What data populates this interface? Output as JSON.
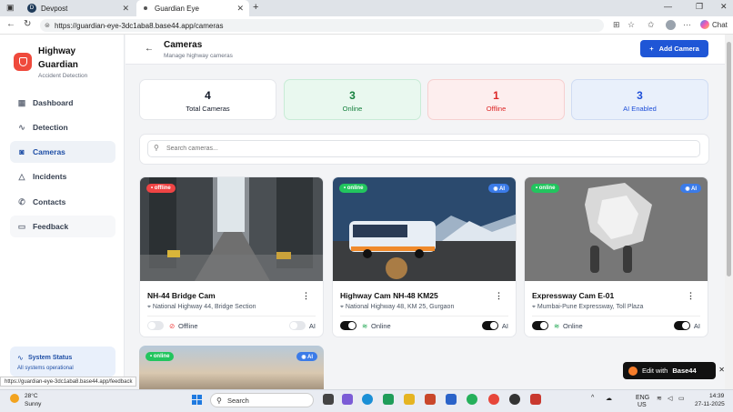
{
  "browser": {
    "tabs": [
      {
        "label": "Devpost",
        "favicon": "D"
      },
      {
        "label": "Guardian Eye"
      }
    ],
    "url": "https://guardian-eye-3dc1aba8.base44.app/cameras",
    "chat_label": "Chat"
  },
  "app": {
    "brand_line1": "Highway",
    "brand_line2": "Guardian",
    "brand_sub": "Accident Detection",
    "nav": [
      {
        "label": "Dashboard",
        "icon": "grid-icon"
      },
      {
        "label": "Detection",
        "icon": "activity-icon"
      },
      {
        "label": "Cameras",
        "icon": "camera-icon",
        "active": true
      },
      {
        "label": "Incidents",
        "icon": "warning-icon"
      },
      {
        "label": "Contacts",
        "icon": "phone-icon"
      },
      {
        "label": "Feedback",
        "icon": "feedback-icon"
      }
    ],
    "system_status": {
      "title": "System Status",
      "sub": "All systems operational"
    },
    "hover_url": "https://guardian-eye-3dc1aba8.base44.app/feedback"
  },
  "header": {
    "title": "Cameras",
    "subtitle": "Manage highway cameras",
    "add_button": "Add Camera"
  },
  "stats": [
    {
      "num": "4",
      "label": "Total Cameras",
      "color": "#111827",
      "bg": "#ffffff",
      "border": "#e5e7eb"
    },
    {
      "num": "3",
      "label": "Online",
      "color": "#15803d",
      "bg": "#e9f8ef",
      "border": "#c8ecd6"
    },
    {
      "num": "1",
      "label": "Offline",
      "color": "#dc2626",
      "bg": "#fdeeee",
      "border": "#f6d0d0"
    },
    {
      "num": "3",
      "label": "AI Enabled",
      "color": "#1d4ed8",
      "bg": "#e9f0fb",
      "border": "#cfdcf3"
    }
  ],
  "search": {
    "placeholder": "Search cameras..."
  },
  "cameras": [
    {
      "name": "NH-44 Bridge Cam",
      "location": "National Highway 44, Bridge Section",
      "status": "offline",
      "status_text": "Offline",
      "ai": false,
      "pill": "• offline"
    },
    {
      "name": "Highway Cam NH-48 KM25",
      "location": "National Highway 48, KM 25, Gurgaon",
      "status": "online",
      "status_text": "Online",
      "ai": true,
      "pill": "• online"
    },
    {
      "name": "Expressway Cam E-01",
      "location": "Mumbai-Pune Expressway, Toll Plaza",
      "status": "online",
      "status_text": "Online",
      "ai": true,
      "pill": "• online"
    },
    {
      "pill": "• online"
    }
  ],
  "ai_label": "AI",
  "ai_pill": "◉ AI",
  "base44": {
    "label": "Edit with",
    "brand": "Base44"
  },
  "taskbar": {
    "temp": "28°C",
    "cond": "Sunny",
    "search": "Search",
    "lang1": "ENG",
    "lang2": "US",
    "time": "14:39",
    "date": "27-11-2025"
  },
  "colors": {
    "accent": "#1f56d6",
    "online": "#16a34a",
    "offline": "#ef4444",
    "brand": "#ef4a3c"
  }
}
